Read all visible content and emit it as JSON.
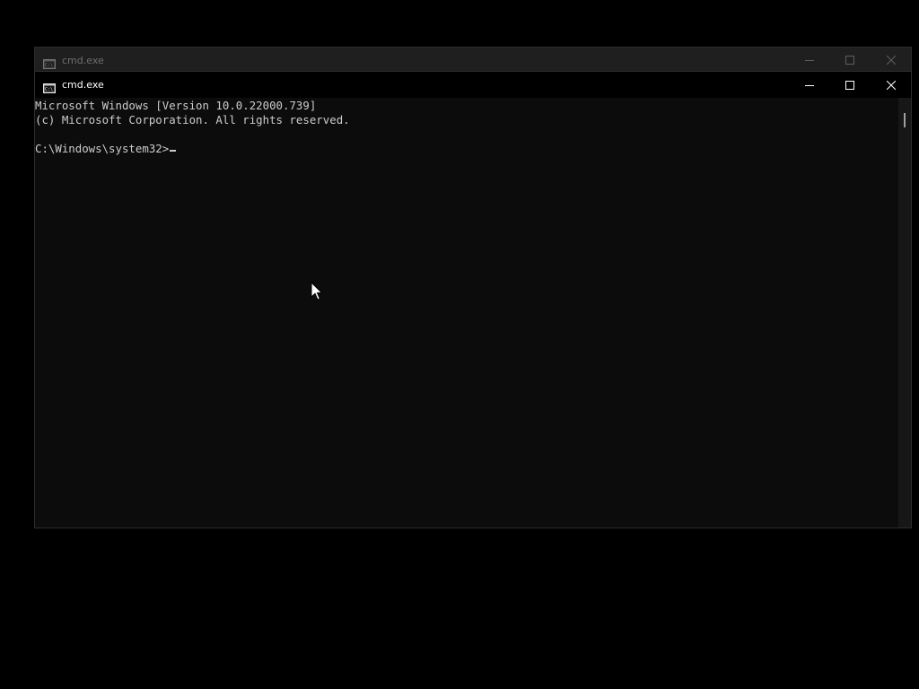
{
  "background_window": {
    "title": "cmd.exe"
  },
  "window": {
    "title": "cmd.exe",
    "icon": "cmd-icon",
    "controls": {
      "minimize_icon": "minimize-icon",
      "maximize_icon": "maximize-icon",
      "close_icon": "close-icon"
    }
  },
  "console": {
    "lines": [
      "Microsoft Windows [Version 10.0.22000.739]",
      "(c) Microsoft Corporation. All rights reserved.",
      "",
      "C:\\Windows\\system32>"
    ],
    "text_color": "#cccccc",
    "background_color": "#0c0c0c"
  }
}
